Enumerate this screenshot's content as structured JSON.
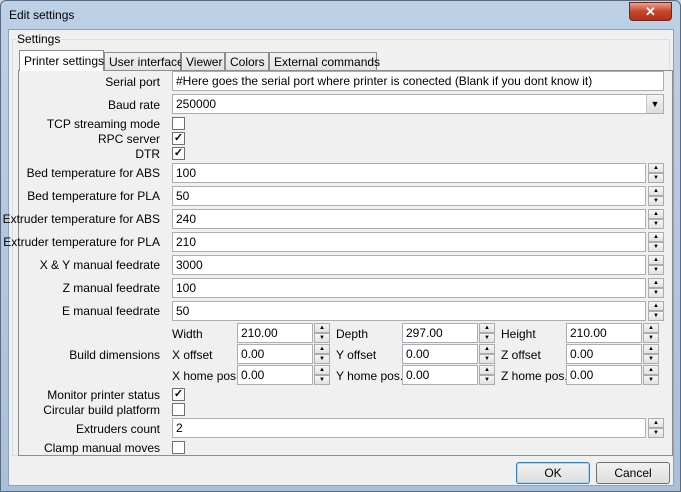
{
  "window": {
    "title": "Edit settings",
    "close_label": "✕"
  },
  "group_label": "Settings",
  "tabs": [
    "Printer settings",
    "User interface",
    "Viewer",
    "Colors",
    "External commands"
  ],
  "form": {
    "serial_port_label": "Serial port",
    "serial_port_value": "#Here goes the serial port where printer is conected (Blank if you dont know it)",
    "baud_rate_label": "Baud rate",
    "baud_rate_value": "250000",
    "tcp_label": "TCP streaming mode",
    "tcp_checked": false,
    "rpc_label": "RPC server",
    "rpc_checked": true,
    "dtr_label": "DTR",
    "dtr_checked": true,
    "bed_abs_label": "Bed temperature for ABS",
    "bed_abs_value": "100",
    "bed_pla_label": "Bed temperature for PLA",
    "bed_pla_value": "50",
    "ext_abs_label": "Extruder temperature for ABS",
    "ext_abs_value": "240",
    "ext_pla_label": "Extruder temperature for PLA",
    "ext_pla_value": "210",
    "xy_feed_label": "X & Y manual feedrate",
    "xy_feed_value": "3000",
    "z_feed_label": "Z manual feedrate",
    "z_feed_value": "100",
    "e_feed_label": "E manual feedrate",
    "e_feed_value": "50",
    "build_dims_label": "Build dimensions",
    "build": {
      "width_label": "Width",
      "width_value": "210.00",
      "depth_label": "Depth",
      "depth_value": "297.00",
      "height_label": "Height",
      "height_value": "210.00",
      "xoff_label": "X offset",
      "xoff_value": "0.00",
      "yoff_label": "Y offset",
      "yoff_value": "0.00",
      "zoff_label": "Z offset",
      "zoff_value": "0.00",
      "xhome_label": "X home pos.",
      "xhome_value": "0.00",
      "yhome_label": "Y home pos.",
      "yhome_value": "0.00",
      "zhome_label": "Z home pos.",
      "zhome_value": "0.00"
    },
    "monitor_label": "Monitor printer status",
    "monitor_checked": true,
    "circular_label": "Circular build platform",
    "circular_checked": false,
    "extruders_label": "Extruders count",
    "extruders_value": "2",
    "clamp_label": "Clamp manual moves",
    "clamp_checked": false
  },
  "buttons": {
    "ok": "OK",
    "cancel": "Cancel"
  }
}
